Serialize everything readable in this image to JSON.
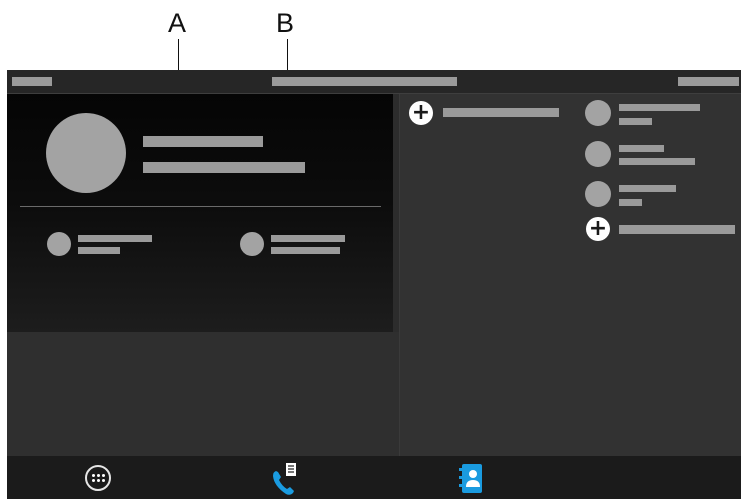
{
  "callouts": {
    "a": "A",
    "b": "B"
  },
  "icons": {
    "add_contact": "plus-icon",
    "add_member": "plus-icon",
    "apps": "apps-grid-icon",
    "call_log": "phone-log-icon",
    "contacts": "contacts-book-icon"
  },
  "colors": {
    "accent": "#1a9be0",
    "placeholder_bar": "#9a9a9a",
    "avatar": "#a3a3a3"
  }
}
